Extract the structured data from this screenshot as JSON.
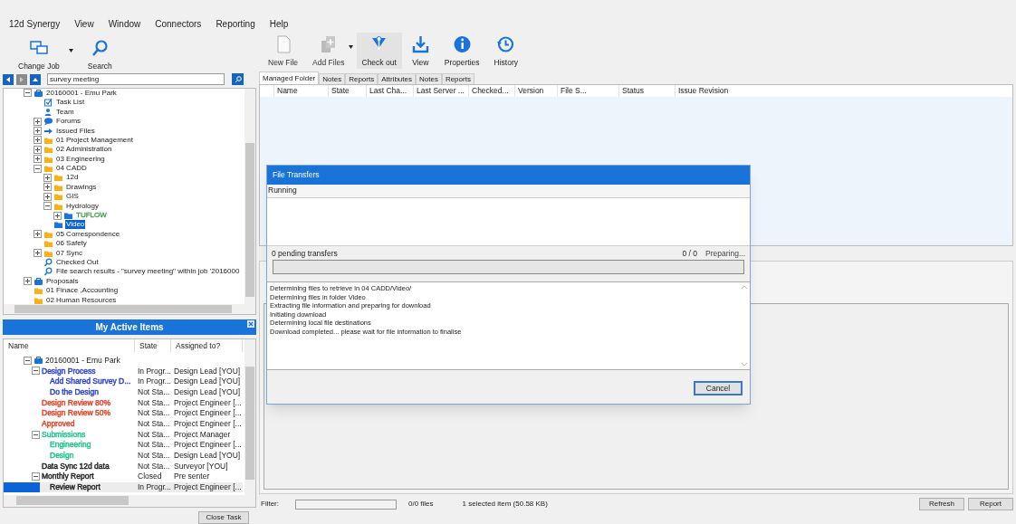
{
  "menu": [
    "12d Synergy",
    "View",
    "Window",
    "Connectors",
    "Reporting",
    "Help"
  ],
  "left_toolbar": [
    {
      "label": "Change Job",
      "kind": "change-job",
      "dropdown": true
    },
    {
      "label": "Search",
      "kind": "search",
      "dropdown": false
    }
  ],
  "right_toolbar": [
    {
      "label": "New File",
      "kind": "new-file",
      "dropdown": false,
      "disabled": true,
      "hovered": false
    },
    {
      "label": "Add Files",
      "kind": "add-files",
      "dropdown": true,
      "disabled": true,
      "hovered": false
    },
    {
      "label": "Check out",
      "kind": "check-out",
      "dropdown": false,
      "disabled": false,
      "hovered": true
    },
    {
      "label": "View",
      "kind": "download",
      "dropdown": false,
      "disabled": false,
      "hovered": false
    },
    {
      "label": "Properties",
      "kind": "info",
      "dropdown": false,
      "disabled": false,
      "hovered": false
    },
    {
      "label": "History",
      "kind": "history",
      "dropdown": false,
      "disabled": false,
      "hovered": false
    }
  ],
  "search_field": {
    "value": "survey meeting"
  },
  "tree": [
    {
      "label": "20160001 - Emu Park",
      "kind": "job",
      "expanded": true,
      "selected": false,
      "children": [
        {
          "label": "Task List",
          "kind": "task",
          "selected": false
        },
        {
          "label": "Team",
          "kind": "team",
          "selected": false
        },
        {
          "label": "Forums",
          "kind": "forum",
          "expanded": false,
          "selected": false
        },
        {
          "label": "Issued Files",
          "kind": "arrow",
          "expanded": false,
          "selected": false
        },
        {
          "label": "01 Project Management",
          "kind": "folder",
          "expanded": false,
          "selected": false
        },
        {
          "label": "02 Administration",
          "kind": "folder",
          "expanded": false,
          "selected": false
        },
        {
          "label": "03 Engineering",
          "kind": "folder",
          "expanded": false,
          "selected": false
        },
        {
          "label": "04 CADD",
          "kind": "folder",
          "expanded": true,
          "selected": false,
          "children": [
            {
              "label": "12d",
              "kind": "folder",
              "expanded": false,
              "selected": false
            },
            {
              "label": "Drawings",
              "kind": "folder",
              "expanded": false,
              "selected": false
            },
            {
              "label": "GIS",
              "kind": "folder",
              "expanded": false,
              "selected": false
            },
            {
              "label": "Hydrology",
              "kind": "folder",
              "expanded": true,
              "selected": false,
              "children": [
                {
                  "label": "TUFLOW",
                  "kind": "folder-blue",
                  "expanded": false,
                  "selected": false,
                  "color": "#3a9a3a"
                }
              ]
            },
            {
              "label": "Video",
              "kind": "folder-blue",
              "selected": true
            }
          ]
        },
        {
          "label": "05 Correspondence",
          "kind": "folder",
          "expanded": false,
          "selected": false
        },
        {
          "label": "06 Safety",
          "kind": "folder",
          "selected": false
        },
        {
          "label": "07 Sync",
          "kind": "folder",
          "expanded": false,
          "selected": false
        },
        {
          "label": "Checked Out",
          "kind": "search",
          "selected": false
        },
        {
          "label": "File search results - \"survey meeting\" within job '2016000",
          "kind": "search",
          "selected": false
        }
      ]
    },
    {
      "label": "Proposals",
      "kind": "job",
      "expanded": false,
      "selected": false
    },
    {
      "label": "01 Finace ,Accounting",
      "kind": "folder",
      "selected": false
    },
    {
      "label": "02 Human Resources",
      "kind": "folder",
      "selected": false
    }
  ],
  "active_items": {
    "title": "My Active Items",
    "columns": [
      "Name",
      "State",
      "Assigned to?"
    ],
    "rows": [
      {
        "name": "20160001 - Emu Park",
        "kind": "job",
        "expanded": true,
        "selected": false,
        "children": [
          {
            "name": "Design Process",
            "state": "In Progr...",
            "assigned": "Design Lead [YOU]",
            "color": "#2b3fd0",
            "expanded": true,
            "selected": false,
            "children": [
              {
                "name": "Add Shared Survey D...",
                "state": "In Progr...",
                "assigned": "Design Lead [YOU]",
                "color": "#2b3fd0",
                "selected": false
              },
              {
                "name": "Do the Design",
                "state": "Not Sta...",
                "assigned": "Design Lead [YOU]",
                "color": "#2b3fd0",
                "selected": false
              }
            ]
          },
          {
            "name": "Design Review 80%",
            "state": "Not Sta...",
            "assigned": "Project Engineer [...",
            "color": "#e0452a",
            "selected": false
          },
          {
            "name": "Design Review 50%",
            "state": "Not Sta...",
            "assigned": "Project Engineer [...",
            "color": "#e0452a",
            "selected": false
          },
          {
            "name": "Approved",
            "state": "Not Sta...",
            "assigned": "Project Engineer [...",
            "color": "#e0452a",
            "selected": false
          },
          {
            "name": "Submissions",
            "state": "Not Sta...",
            "assigned": "Project Manager",
            "color": "#1fc48a",
            "expanded": true,
            "selected": false,
            "children": [
              {
                "name": "Engineering",
                "state": "Not Sta...",
                "assigned": "Project Engineer [...",
                "color": "#1fc48a",
                "selected": false
              },
              {
                "name": "Design",
                "state": "Not Sta...",
                "assigned": "Design Lead [YOU]",
                "color": "#1fc48a",
                "selected": false
              }
            ]
          },
          {
            "name": "Data Sync 12d data",
            "state": "Not Sta...",
            "assigned": "Surveyor [YOU]",
            "color": "#222222",
            "selected": false
          },
          {
            "name": "Monthly Report",
            "state": "Closed",
            "assigned": "Pre senter",
            "color": "#222222",
            "expanded": true,
            "selected": false,
            "children": [
              {
                "name": "Review Report",
                "state": "In Progr...",
                "assigned": "Project Engineer [...",
                "color": "#222222",
                "selected": true
              }
            ]
          }
        ]
      }
    ],
    "close_task": "Close Task"
  },
  "tabs": [
    {
      "label": "Managed Folder",
      "selected": true
    },
    {
      "label": "Notes",
      "selected": false
    },
    {
      "label": "Reports",
      "selected": false
    },
    {
      "label": "Attributes",
      "selected": false
    },
    {
      "label": "Notes",
      "selected": false
    },
    {
      "label": "Reports",
      "selected": false
    }
  ],
  "table": {
    "columns": [
      "Name",
      "State",
      "Last Cha...",
      "Last Server ...",
      "Checked...",
      "Version",
      "File S...",
      "Status",
      "Issue Revision"
    ]
  },
  "dialog": {
    "title": "File Transfers",
    "status": "Running",
    "pending": "0 pending transfers",
    "count": "0 / 0",
    "phase": "Preparing...",
    "level": 0,
    "log": [
      "Determining files to retrieve in 04 CADD/Video/",
      "Determining files in folder Video",
      "Extracting file information and preparing for download",
      "Initiating download",
      "Determining local file destinations",
      "Download completed... please wait for file information to finalise"
    ],
    "cancel": "Cancel"
  },
  "status_bar": {
    "filter_label": "Filter:",
    "files": "0/0 files",
    "selection": "1 selected item (50.58 KB)",
    "buttons": [
      "Refresh",
      "Report"
    ]
  }
}
